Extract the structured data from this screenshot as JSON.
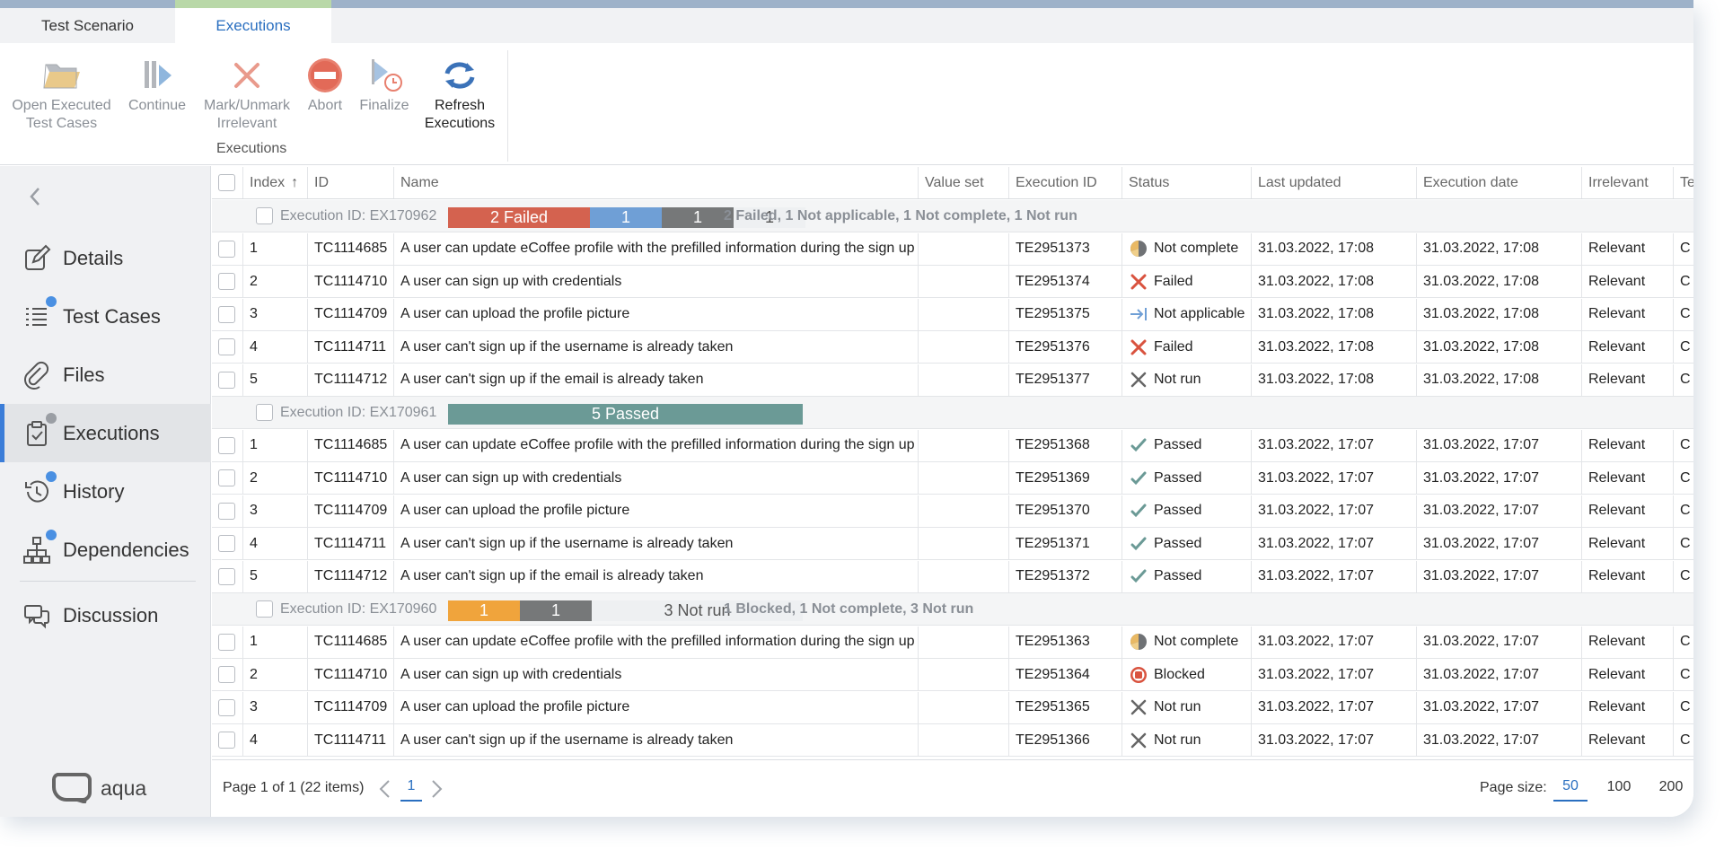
{
  "tabs": [
    {
      "label": "Test Scenario",
      "active": false
    },
    {
      "label": "Executions",
      "active": true
    }
  ],
  "ribbon": {
    "buttons": [
      {
        "line1": "Open Executed",
        "line2": "Test Cases",
        "icon": "folder-open-icon"
      },
      {
        "line1": "Continue",
        "line2": "",
        "icon": "continue-icon"
      },
      {
        "line1": "Mark/Unmark",
        "line2": "Irrelevant",
        "icon": "x-mark-icon"
      },
      {
        "line1": "Abort",
        "line2": "",
        "icon": "abort-icon"
      },
      {
        "line1": "Finalize",
        "line2": "",
        "icon": "finalize-icon"
      },
      {
        "line1": "Refresh",
        "line2": "Executions",
        "icon": "refresh-icon"
      }
    ],
    "group_label": "Executions"
  },
  "sidebar": {
    "items": [
      {
        "label": "Details",
        "icon": "edit-icon",
        "dot": null
      },
      {
        "label": "Test Cases",
        "icon": "list-icon",
        "dot": "#4a90e2"
      },
      {
        "label": "Files",
        "icon": "paperclip-icon",
        "dot": null
      },
      {
        "label": "Executions",
        "icon": "clipboard-check-icon",
        "dot": "#9a9ea4",
        "active": true
      },
      {
        "label": "History",
        "icon": "history-icon",
        "dot": "#4a90e2"
      },
      {
        "label": "Dependencies",
        "icon": "hierarchy-icon",
        "dot": "#4a90e2"
      },
      {
        "label": "Discussion",
        "icon": "chat-icon",
        "dot": null
      }
    ],
    "logo_text": "aqua"
  },
  "grid": {
    "columns": {
      "index": "Index",
      "id": "ID",
      "name": "Name",
      "value_set": "Value set",
      "execution_id": "Execution ID",
      "status": "Status",
      "last_updated": "Last updated",
      "execution_date": "Execution date",
      "irrelevant": "Irrelevant",
      "te": "Te"
    },
    "groups": [
      {
        "label": "Execution ID: EX170962",
        "bars": [
          {
            "text": "2 Failed",
            "color": "#d4624f",
            "light": false
          },
          {
            "text": "1",
            "color": "#6f9fd6",
            "light": false
          },
          {
            "text": "1",
            "color": "#767879",
            "light": false
          },
          {
            "text": "1",
            "color": "#eef0f2",
            "light": true
          }
        ],
        "summary": "2 Failed, 1 Not applicable, 1 Not complete, 1 Not run",
        "rows": [
          {
            "index": "1",
            "id": "TC1114685",
            "name": "A user can update eCoffee profile with the prefilled information during the sign up",
            "value_set": "",
            "execution_id": "TE2951373",
            "status": "Not complete",
            "status_icon": "not-complete-icon",
            "last_updated": "31.03.2022, 17:08",
            "execution_date": "31.03.2022, 17:08",
            "irrelevant": "Relevant",
            "te": "C"
          },
          {
            "index": "2",
            "id": "TC1114710",
            "name": "A user can sign up with credentials",
            "value_set": "",
            "execution_id": "TE2951374",
            "status": "Failed",
            "status_icon": "failed-icon",
            "last_updated": "31.03.2022, 17:08",
            "execution_date": "31.03.2022, 17:08",
            "irrelevant": "Relevant",
            "te": "C"
          },
          {
            "index": "3",
            "id": "TC1114709",
            "name": "A user can upload the profile picture",
            "value_set": "",
            "execution_id": "TE2951375",
            "status": "Not applicable",
            "status_icon": "not-applicable-icon",
            "last_updated": "31.03.2022, 17:08",
            "execution_date": "31.03.2022, 17:08",
            "irrelevant": "Relevant",
            "te": "C"
          },
          {
            "index": "4",
            "id": "TC1114711",
            "name": "A user can't sign up if the username is already taken",
            "value_set": "",
            "execution_id": "TE2951376",
            "status": "Failed",
            "status_icon": "failed-icon",
            "last_updated": "31.03.2022, 17:08",
            "execution_date": "31.03.2022, 17:08",
            "irrelevant": "Relevant",
            "te": "C"
          },
          {
            "index": "5",
            "id": "TC1114712",
            "name": "A user can't sign up if the email is already taken",
            "value_set": "",
            "execution_id": "TE2951377",
            "status": "Not run",
            "status_icon": "not-run-icon",
            "last_updated": "31.03.2022, 17:08",
            "execution_date": "31.03.2022, 17:08",
            "irrelevant": "Relevant",
            "te": "C"
          }
        ]
      },
      {
        "label": "Execution ID: EX170961",
        "bars": [
          {
            "text": "5 Passed",
            "color": "#6b9a96",
            "light": false
          }
        ],
        "summary": "",
        "rows": [
          {
            "index": "1",
            "id": "TC1114685",
            "name": "A user can update eCoffee profile with the prefilled information during the sign up",
            "value_set": "",
            "execution_id": "TE2951368",
            "status": "Passed",
            "status_icon": "passed-icon",
            "last_updated": "31.03.2022, 17:07",
            "execution_date": "31.03.2022, 17:07",
            "irrelevant": "Relevant",
            "te": "C"
          },
          {
            "index": "2",
            "id": "TC1114710",
            "name": "A user can sign up with credentials",
            "value_set": "",
            "execution_id": "TE2951369",
            "status": "Passed",
            "status_icon": "passed-icon",
            "last_updated": "31.03.2022, 17:07",
            "execution_date": "31.03.2022, 17:07",
            "irrelevant": "Relevant",
            "te": "C"
          },
          {
            "index": "3",
            "id": "TC1114709",
            "name": "A user can upload the profile picture",
            "value_set": "",
            "execution_id": "TE2951370",
            "status": "Passed",
            "status_icon": "passed-icon",
            "last_updated": "31.03.2022, 17:07",
            "execution_date": "31.03.2022, 17:07",
            "irrelevant": "Relevant",
            "te": "C"
          },
          {
            "index": "4",
            "id": "TC1114711",
            "name": "A user can't sign up if the username is already taken",
            "value_set": "",
            "execution_id": "TE2951371",
            "status": "Passed",
            "status_icon": "passed-icon",
            "last_updated": "31.03.2022, 17:07",
            "execution_date": "31.03.2022, 17:07",
            "irrelevant": "Relevant",
            "te": "C"
          },
          {
            "index": "5",
            "id": "TC1114712",
            "name": "A user can't sign up if the email is already taken",
            "value_set": "",
            "execution_id": "TE2951372",
            "status": "Passed",
            "status_icon": "passed-icon",
            "last_updated": "31.03.2022, 17:07",
            "execution_date": "31.03.2022, 17:07",
            "irrelevant": "Relevant",
            "te": "C"
          }
        ]
      },
      {
        "label": "Execution ID: EX170960",
        "bars": [
          {
            "text": "1",
            "color": "#f0a43c",
            "light": false
          },
          {
            "text": "1",
            "color": "#767879",
            "light": false
          },
          {
            "text": "3 Not run",
            "color": "#eef0f2",
            "light": true
          }
        ],
        "summary": "1 Blocked, 1 Not complete, 3 Not run",
        "rows": [
          {
            "index": "1",
            "id": "TC1114685",
            "name": "A user can update eCoffee profile with the prefilled information during the sign up",
            "value_set": "",
            "execution_id": "TE2951363",
            "status": "Not complete",
            "status_icon": "not-complete-icon",
            "last_updated": "31.03.2022, 17:07",
            "execution_date": "31.03.2022, 17:07",
            "irrelevant": "Relevant",
            "te": "C"
          },
          {
            "index": "2",
            "id": "TC1114710",
            "name": "A user can sign up with credentials",
            "value_set": "",
            "execution_id": "TE2951364",
            "status": "Blocked",
            "status_icon": "blocked-icon",
            "last_updated": "31.03.2022, 17:07",
            "execution_date": "31.03.2022, 17:07",
            "irrelevant": "Relevant",
            "te": "C"
          },
          {
            "index": "3",
            "id": "TC1114709",
            "name": "A user can upload the profile picture",
            "value_set": "",
            "execution_id": "TE2951365",
            "status": "Not run",
            "status_icon": "not-run-icon",
            "last_updated": "31.03.2022, 17:07",
            "execution_date": "31.03.2022, 17:07",
            "irrelevant": "Relevant",
            "te": "C"
          },
          {
            "index": "4",
            "id": "TC1114711",
            "name": "A user can't sign up if the username is already taken",
            "value_set": "",
            "execution_id": "TE2951366",
            "status": "Not run",
            "status_icon": "not-run-icon",
            "last_updated": "31.03.2022, 17:07",
            "execution_date": "31.03.2022, 17:07",
            "irrelevant": "Relevant",
            "te": "C"
          }
        ]
      }
    ]
  },
  "footer": {
    "page_info": "Page 1 of 1 (22 items)",
    "current_page": "1",
    "page_size_label": "Page size:",
    "page_sizes": [
      "50",
      "100",
      "200"
    ],
    "selected_page_size": "50"
  },
  "colors": {
    "accent": "#2a6fc0",
    "failed": "#d4624f",
    "not_applicable": "#6f9fd6",
    "not_complete": "#767879",
    "passed": "#6b9a96",
    "blocked": "#f0a43c"
  }
}
